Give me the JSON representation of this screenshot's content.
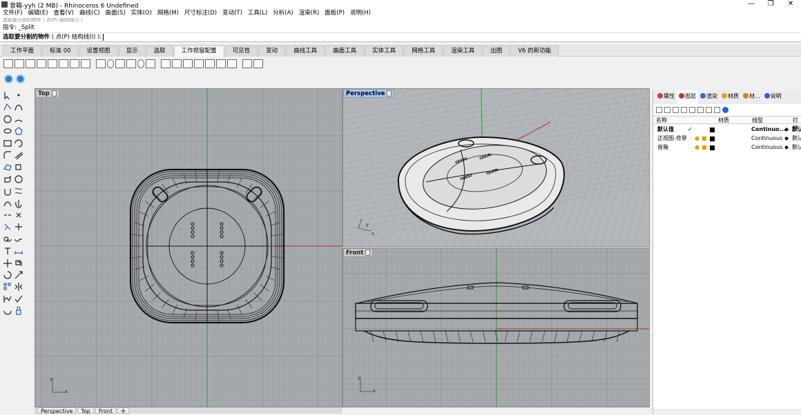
{
  "window": {
    "title": "音箱-yyh (2 MB) - Rhinoceros 6 Undefined",
    "minimize": "—",
    "maximize": "❐",
    "close": "✕"
  },
  "menu": [
    "文件(F)",
    "编辑(E)",
    "查看(V)",
    "曲线(C)",
    "曲面(S)",
    "实体(O)",
    "网格(M)",
    "尺寸标注(D)",
    "变动(T)",
    "工具(L)",
    "分析(A)",
    "渲染(R)",
    "面板(P)",
    "说明(H)"
  ],
  "command": {
    "history": "选取要分割的物件 ( 点(P)  结构线(I) )",
    "line1": "指令: _Split",
    "prompt": "选取要分割的物件",
    "options": "( 点(P)  结构线(I) ):"
  },
  "tabs": [
    "工作平面",
    "标准 00",
    "设置视图",
    "显示",
    "选取",
    "工作视窗配置",
    "可见性",
    "变动",
    "曲线工具",
    "曲面工具",
    "实体工具",
    "网格工具",
    "渲染工具",
    "出图",
    "V6 的新功能"
  ],
  "active_tab": "工作视窗配置",
  "viewports": {
    "top": {
      "title": "Top"
    },
    "perspective": {
      "title": "Perspective"
    },
    "front": {
      "title": "Front"
    }
  },
  "axis_labels": {
    "x": "x",
    "y": "y"
  },
  "bottom_tabs": [
    "Perspective",
    "Top",
    "Front",
    "✢"
  ],
  "panel": {
    "tabs": [
      "属性",
      "图层",
      "渲染",
      "材质",
      "材...",
      "说明"
    ],
    "tab_icon_colors": [
      "#d04040",
      "#c03030",
      "#3070c0",
      "#e0a030",
      "#d08020",
      "#3060c0"
    ],
    "columns": {
      "name": "名称",
      "material": "材质",
      "linetype": "线型",
      "print": "打印"
    },
    "layers": [
      {
        "name": "默认值",
        "linetype": "Continuo...",
        "print": "默认",
        "current": "✓"
      },
      {
        "name": "正视图-背景",
        "linetype": "Continuous",
        "print": "默认",
        "current": ""
      },
      {
        "name": "音箱",
        "linetype": "Continuous",
        "print": "默认",
        "current": ""
      }
    ]
  }
}
